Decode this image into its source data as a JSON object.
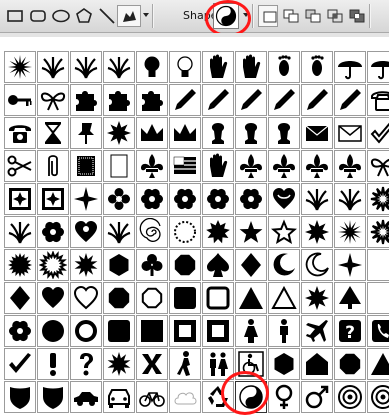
{
  "toolbar": {
    "tools": [
      {
        "name": "rectangle-tool-icon",
        "glyph": "rectangle"
      },
      {
        "name": "rounded-rectangle-tool-icon",
        "glyph": "rounded-rectangle"
      },
      {
        "name": "ellipse-tool-icon",
        "glyph": "ellipse"
      },
      {
        "name": "polygon-tool-icon",
        "glyph": "polygon"
      },
      {
        "name": "line-tool-icon",
        "glyph": "line"
      },
      {
        "name": "custom-shape-tool-icon",
        "glyph": "custom-shape"
      }
    ],
    "shape_label": "Shape:",
    "current_shape_icon": "yin-yang",
    "combine_modes": [
      "create-new-shape-layer-icon",
      "add-to-shape-area-icon",
      "subtract-from-shape-area-icon",
      "intersect-shape-areas-icon",
      "exclude-overlapping-shape-areas-icon"
    ]
  },
  "highlight_color": "#ff1818",
  "shape_picker": {
    "selected_icon": "yin-yang",
    "rows": [
      [
        "asterisk-burst",
        "grass-1",
        "grass-2",
        "grass-3",
        "light-bulb",
        "light-bulb-outline",
        "hand-1",
        "hand-2",
        "footprint-1",
        "footprint-2",
        "umbrella",
        "umbrella-2"
      ],
      [
        "key",
        "bow",
        "puzzle-1",
        "puzzle-2",
        "puzzle-3",
        "pencil",
        "brush",
        "feather-pen",
        "stick",
        "flashlight",
        "pen",
        "telephone-outline"
      ],
      [
        "telephone",
        "hourglass",
        "thumbtack",
        "star-seal",
        "crown-1",
        "crown-2",
        "king-chess",
        "queen-chess",
        "bishop-chess",
        "envelope",
        "envelope-open",
        "check-mark-outline"
      ],
      [
        "scissors",
        "paper-clip",
        "square-pattern",
        "blank-page",
        "ornament-leaves",
        "flag",
        "hand-pointer",
        "curly-ornament",
        "fleur-de-lis",
        "triple-ornament",
        "fleur-ornament",
        "ribbon-ornament"
      ],
      [
        "framed-square-1",
        "framed-square-2",
        "diamond-cross",
        "four-point-flower",
        "ornament-star",
        "rosette",
        "flower-ornament-1",
        "flower-ornament-2",
        "heart-ornament",
        "tree-ornament",
        "vine-ornament",
        "sparkle-ornament"
      ],
      [
        "leaf-branch",
        "daisy",
        "heart-rose",
        "leaf-sprig",
        "spiral",
        "dots-ring",
        "splat",
        "five-point-star",
        "five-point-star-outline",
        "octagon-star",
        "sun-burst",
        "sun-burst-outline"
      ],
      [
        "starburst",
        "starburst-outline",
        "sunburst-2",
        "hexagon",
        "clover",
        "circle-seal",
        "spade",
        "diamond",
        "crescent",
        "crescent-outline",
        "sparkle",
        "blank"
      ],
      [
        "diamond-suit",
        "heart",
        "heart-outline",
        "octagon-seal",
        "octagon-seal-outline",
        "rounded-square",
        "square-outline",
        "triangle",
        "triangle-outline",
        "splash",
        "tree",
        "blank"
      ],
      [
        "flower",
        "circle",
        "ring",
        "rounded-square-2",
        "square",
        "square-frame",
        "frame-hollow",
        "female-figure",
        "male-figure",
        "airplane",
        "question-box",
        "telephone-box"
      ],
      [
        "check-mark",
        "exclamation",
        "question-mark",
        "burst",
        "x-mark",
        "walking-man",
        "couple",
        "wheelchair",
        "hexagon-2",
        "pentagon-arrow",
        "octagon-2",
        "triangle-2"
      ],
      [
        "shield",
        "shield-2",
        "car-side",
        "car-front",
        "bicycle",
        "cloud-outline",
        "recycle",
        "yin-yang",
        "female-symbol",
        "male-symbol",
        "target",
        "target-2"
      ]
    ]
  }
}
